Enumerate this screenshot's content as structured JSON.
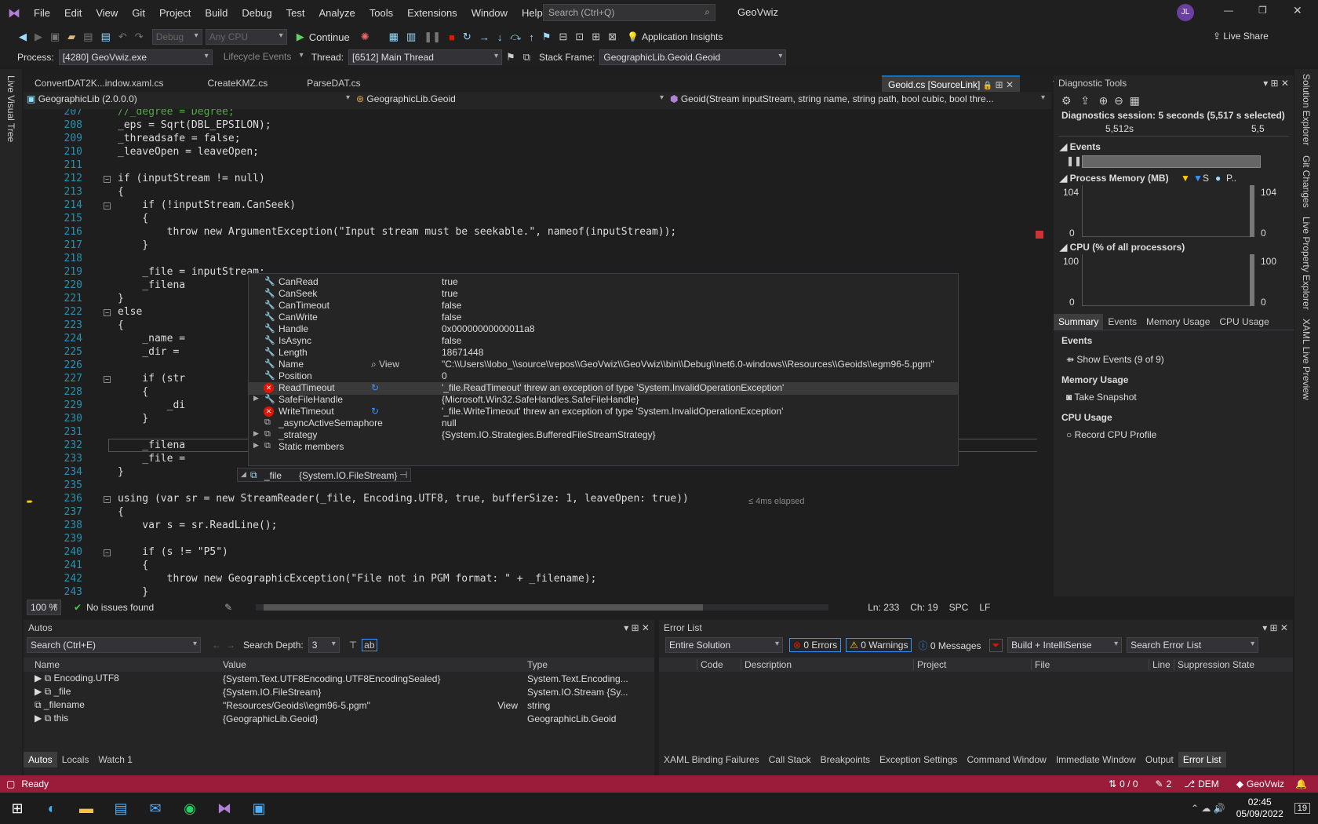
{
  "titlebar": {
    "menu": [
      "File",
      "Edit",
      "View",
      "Git",
      "Project",
      "Build",
      "Debug",
      "Test",
      "Analyze",
      "Tools",
      "Extensions",
      "Window",
      "Help"
    ],
    "search_placeholder": "Search (Ctrl+Q)",
    "app_title": "GeoVwiz",
    "user_initials": "JL"
  },
  "toolbar": {
    "config": "Debug",
    "platform": "Any CPU",
    "continue": "Continue",
    "app_insights": "Application Insights",
    "live_share": "Live Share"
  },
  "debugbar": {
    "process_label": "Process:",
    "process": "[4280] GeoVwiz.exe",
    "lifecycle": "Lifecycle Events",
    "thread_label": "Thread:",
    "thread": "[6512] Main Thread",
    "stackframe_label": "Stack Frame:",
    "stackframe": "GeographicLib.Geoid.Geoid"
  },
  "side_left": {
    "live_visual_tree": "Live Visual Tree"
  },
  "side_right": [
    "Solution Explorer",
    "Git Changes",
    "Live Property Explorer",
    "XAML Live Preview"
  ],
  "tabs": [
    "ConvertDAT2K...indow.xaml.cs",
    "CreateKMZ.cs",
    "ParseDAT.cs"
  ],
  "active_tab": "Geoid.cs [SourceLink]",
  "navbar": {
    "project": "GeographicLib (2.0.0.0)",
    "class": "GeographicLib.Geoid",
    "member": "Geoid(Stream inputStream, string name, string path, bool cubic, bool thre..."
  },
  "code_lines": [
    {
      "n": "207",
      "t": "//_degree = Degree;"
    },
    {
      "n": "208",
      "t": "_eps = Sqrt(DBL_EPSILON);"
    },
    {
      "n": "209",
      "t": "_threadsafe = false;"
    },
    {
      "n": "210",
      "t": "_leaveOpen = leaveOpen;"
    },
    {
      "n": "211",
      "t": ""
    },
    {
      "n": "212",
      "t": "if (inputStream != null)"
    },
    {
      "n": "213",
      "t": "{"
    },
    {
      "n": "214",
      "t": "    if (!inputStream.CanSeek)"
    },
    {
      "n": "215",
      "t": "    {"
    },
    {
      "n": "216",
      "t": "        throw new ArgumentException(\"Input stream must be seekable.\", nameof(inputStream));"
    },
    {
      "n": "217",
      "t": "    }"
    },
    {
      "n": "218",
      "t": ""
    },
    {
      "n": "219",
      "t": "    _file = inputStream;"
    },
    {
      "n": "220",
      "t": "    _filena"
    },
    {
      "n": "221",
      "t": "}"
    },
    {
      "n": "222",
      "t": "else"
    },
    {
      "n": "223",
      "t": "{"
    },
    {
      "n": "224",
      "t": "    _name ="
    },
    {
      "n": "225",
      "t": "    _dir ="
    },
    {
      "n": "226",
      "t": ""
    },
    {
      "n": "227",
      "t": "    if (str"
    },
    {
      "n": "228",
      "t": "    {"
    },
    {
      "n": "229",
      "t": "        _di"
    },
    {
      "n": "230",
      "t": "    }"
    },
    {
      "n": "231",
      "t": ""
    },
    {
      "n": "232",
      "t": "    _filena"
    },
    {
      "n": "233",
      "t": "    _file ="
    },
    {
      "n": "234",
      "t": "}"
    },
    {
      "n": "235",
      "t": ""
    },
    {
      "n": "236",
      "t": "using (var sr = new StreamReader(_file, Encoding.UTF8, true, bufferSize: 1, leaveOpen: true))"
    },
    {
      "n": "237",
      "t": "{"
    },
    {
      "n": "238",
      "t": "    var s = sr.ReadLine();"
    },
    {
      "n": "239",
      "t": ""
    },
    {
      "n": "240",
      "t": "    if (s != \"P5\")"
    },
    {
      "n": "241",
      "t": "    {"
    },
    {
      "n": "242",
      "t": "        throw new GeographicException(\"File not in PGM format: \" + _filename);"
    },
    {
      "n": "243",
      "t": "    }"
    }
  ],
  "elapsed": "≤ 4ms elapsed",
  "datatip": [
    {
      "name": "CanRead",
      "value": "true",
      "kind": "prop"
    },
    {
      "name": "CanSeek",
      "value": "true",
      "kind": "prop"
    },
    {
      "name": "CanTimeout",
      "value": "false",
      "kind": "prop"
    },
    {
      "name": "CanWrite",
      "value": "false",
      "kind": "prop"
    },
    {
      "name": "Handle",
      "value": "0x00000000000011a8",
      "kind": "prop"
    },
    {
      "name": "IsAsync",
      "value": "false",
      "kind": "prop"
    },
    {
      "name": "Length",
      "value": "18671448",
      "kind": "prop"
    },
    {
      "name": "Name",
      "value": "\"C:\\\\Users\\\\lobo_\\\\source\\\\repos\\\\GeoVwiz\\\\GeoVwiz\\\\bin\\\\Debug\\\\net6.0-windows\\\\Resources\\\\Geoids\\\\egm96-5.pgm\"",
      "kind": "prop",
      "view": "View"
    },
    {
      "name": "Position",
      "value": "0",
      "kind": "prop"
    },
    {
      "name": "ReadTimeout",
      "value": "'_file.ReadTimeout' threw an exception of type 'System.InvalidOperationException'",
      "kind": "err"
    },
    {
      "name": "SafeFileHandle",
      "value": "{Microsoft.Win32.SafeHandles.SafeFileHandle}",
      "kind": "exp"
    },
    {
      "name": "WriteTimeout",
      "value": "'_file.WriteTimeout' threw an exception of type 'System.InvalidOperationException'",
      "kind": "err"
    },
    {
      "name": "_asyncActiveSemaphore",
      "value": "null",
      "kind": "field"
    },
    {
      "name": "_strategy",
      "value": "{System.IO.Strategies.BufferedFileStreamStrategy}",
      "kind": "fieldexp"
    },
    {
      "name": "Static members",
      "value": "",
      "kind": "static"
    }
  ],
  "datatip_root": {
    "name": "_file",
    "value": "{System.IO.FileStream}"
  },
  "editor_status": {
    "zoom": "100 %",
    "issues": "No issues found",
    "ln": "Ln: 233",
    "ch": "Ch: 19",
    "spc": "SPC",
    "lf": "LF"
  },
  "diag": {
    "title": "Diagnostic Tools",
    "session": "Diagnostics session: 5 seconds (5,517 s selected)",
    "t1": "5,512s",
    "t2": "5,5",
    "events": "Events",
    "mem": "Process Memory (MB)",
    "mem_max": "104",
    "mem_min": "0",
    "mem_s": "S",
    "mem_p": "P..",
    "cpu": "CPU (% of all processors)",
    "cpu_max": "100",
    "cpu_min": "0",
    "tabs": [
      "Summary",
      "Events",
      "Memory Usage",
      "CPU Usage"
    ],
    "sec_events": "Events",
    "show_events": "Show Events (9 of 9)",
    "sec_mem": "Memory Usage",
    "take_snapshot": "Take Snapshot",
    "sec_cpu": "CPU Usage",
    "record_cpu": "Record CPU Profile"
  },
  "autos": {
    "title": "Autos",
    "search": "Search (Ctrl+E)",
    "depth_label": "Search Depth:",
    "depth": "3",
    "cols": [
      "Name",
      "Value",
      "Type"
    ],
    "rows": [
      {
        "name": "Encoding.UTF8",
        "value": "{System.Text.UTF8Encoding.UTF8EncodingSealed}",
        "type": "System.Text.Encoding..."
      },
      {
        "name": "_file",
        "value": "{System.IO.FileStream}",
        "type": "System.IO.Stream {Sy..."
      },
      {
        "name": "_filename",
        "value": "\"Resources/Geoids\\\\egm96-5.pgm\"",
        "type": "string",
        "view": "View"
      },
      {
        "name": "this",
        "value": "{GeographicLib.Geoid}",
        "type": "GeographicLib.Geoid"
      }
    ],
    "tabs": [
      "Autos",
      "Locals",
      "Watch 1"
    ]
  },
  "errlist": {
    "title": "Error List",
    "scope": "Entire Solution",
    "errors": "0 Errors",
    "warnings": "0 Warnings",
    "messages": "0 Messages",
    "build": "Build + IntelliSense",
    "search": "Search Error List",
    "cols": [
      "Code",
      "Description",
      "Project",
      "File",
      "Line",
      "Suppression State"
    ],
    "tabs": [
      "XAML Binding Failures",
      "Call Stack",
      "Breakpoints",
      "Exception Settings",
      "Command Window",
      "Immediate Window",
      "Output",
      "Error List"
    ]
  },
  "statusbar": {
    "ready": "Ready",
    "updown": "0 / 0",
    "pencil": "2",
    "branch": "DEM",
    "repo": "GeoVwiz"
  },
  "taskbar": {
    "time": "02:45",
    "date": "05/09/2022",
    "notif": "19"
  }
}
